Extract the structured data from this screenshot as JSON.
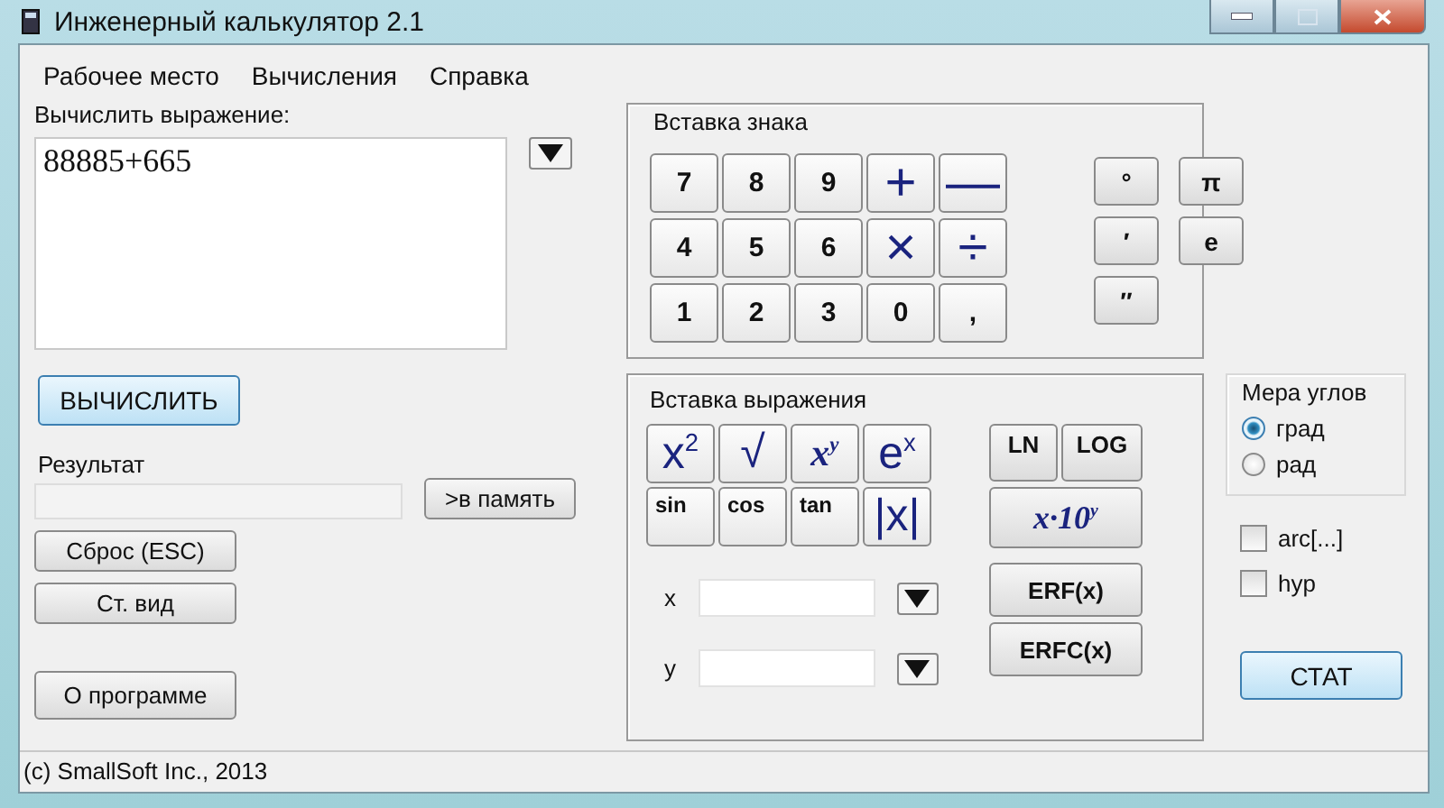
{
  "window": {
    "title": "Инженерный калькулятор 2.1"
  },
  "menu": [
    {
      "label": "Рабочее место"
    },
    {
      "label": "Вычисления"
    },
    {
      "label": "Справка"
    }
  ],
  "expression": {
    "label": "Вычислить выражение:",
    "value": "88885+665"
  },
  "calculate_button": "ВЫЧИСЛИТЬ",
  "result": {
    "label": "Результат",
    "memory_button": ">в память"
  },
  "left_buttons": [
    {
      "label": "Сброс (ESC)",
      "kind": "small"
    },
    {
      "label": "Ст. вид",
      "kind": "small"
    },
    {
      "label": "О программе",
      "kind": "spaced"
    }
  ],
  "sign_insert": {
    "title": "Вставка знака",
    "keys": [
      {
        "label": "7",
        "kind": "digit"
      },
      {
        "label": "8",
        "kind": "digit"
      },
      {
        "label": "9",
        "kind": "digit"
      },
      {
        "label": "+",
        "kind": "operator"
      },
      {
        "label": "—",
        "kind": "operator"
      },
      {
        "label": "4",
        "kind": "digit"
      },
      {
        "label": "5",
        "kind": "digit"
      },
      {
        "label": "6",
        "kind": "digit"
      },
      {
        "label": "×",
        "kind": "operator"
      },
      {
        "label": "÷",
        "kind": "operator"
      },
      {
        "label": "1",
        "kind": "digit"
      },
      {
        "label": "2",
        "kind": "digit"
      },
      {
        "label": "3",
        "kind": "digit"
      },
      {
        "label": "0",
        "kind": "digit"
      },
      {
        "label": ",",
        "kind": "digit"
      }
    ],
    "symbols": [
      {
        "label": "°"
      },
      {
        "label": "π"
      },
      {
        "label": "′"
      },
      {
        "label": "e"
      },
      {
        "label": "″"
      }
    ]
  },
  "expression_insert": {
    "title": "Вставка выражения",
    "functions": [
      {
        "label": "x$^{2}$",
        "kind": "symbol"
      },
      {
        "label": "√",
        "kind": "symbol"
      },
      {
        "label": "x$^{y}$",
        "kind": "serif"
      },
      {
        "label": "e$^{x}$",
        "kind": "symbol"
      },
      {
        "label": "sin",
        "kind": "word"
      },
      {
        "label": "cos",
        "kind": "word"
      },
      {
        "label": "tan",
        "kind": "word"
      },
      {
        "label": "|x|",
        "kind": "symbol"
      }
    ],
    "side_buttons": [
      {
        "label": "LN",
        "kind": "half"
      },
      {
        "label": "LOG",
        "kind": "half"
      },
      {
        "label": "x·10$^{y}$",
        "kind": "serif"
      },
      {
        "label": "ERF(x)",
        "kind": "full"
      },
      {
        "label": "ERFC(x)",
        "kind": "full"
      }
    ],
    "variables": [
      {
        "label": "x"
      },
      {
        "label": "y"
      }
    ]
  },
  "angle_units": {
    "title": "Мера углов",
    "options": [
      {
        "label": "град",
        "selected": true
      },
      {
        "label": "рад",
        "selected": false
      }
    ]
  },
  "options": [
    {
      "label": "arc[...]",
      "checked": false
    },
    {
      "label": "hyp",
      "checked": false
    }
  ],
  "stat_button": "СТАТ",
  "status_bar": "(c) SmallSoft Inc., 2013"
}
